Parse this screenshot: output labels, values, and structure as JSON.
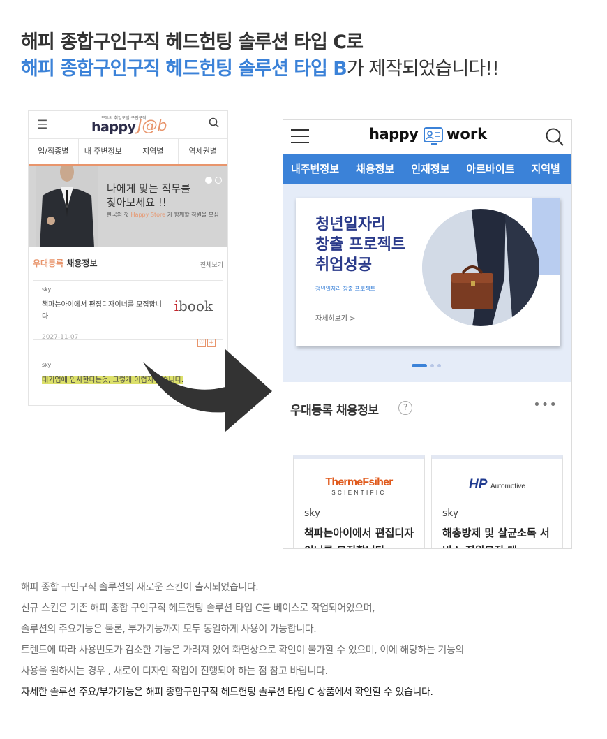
{
  "headline": {
    "line1": "해피 종합구인구직 헤드헌팅 솔루션 타입 C로",
    "line2_highlight": "해피 종합구인구직 헤드헌팅 솔루션 타입 B",
    "line2_rest": "가 제작되었습니다!!"
  },
  "old_skin": {
    "logo_tag": "모두의 취업포털 구인구직",
    "logo_happy": "happy",
    "logo_job": "J@b",
    "tabs": [
      "업/직종별",
      "내 주변정보",
      "지역별",
      "역세권별"
    ],
    "banner_title_1": "나에게 맞는 직무를",
    "banner_title_2": "찾아보세요 !!",
    "banner_sub_1": "한국의 첫 ",
    "banner_sub_highlight": "Happy Store",
    "banner_sub_2": " 가 함께할 직원을 모집",
    "section_title_highlight": "우대등록",
    "section_title_rest": " 채용정보",
    "section_more": "전체보기",
    "card1_company": "sky",
    "card1_text": "책파는아이에서 편집디자이너를 모집합니다",
    "card1_logo_i": "i",
    "card1_logo_rest": "book",
    "card1_date": "2027-11-07",
    "card2_company": "sky",
    "card2_text": "대기업에 입사한다는것, 그렇게 어렵지 않습니다."
  },
  "new_skin": {
    "logo_happy": "happy",
    "logo_work": "work",
    "nav": [
      "내주변정보",
      "채용정보",
      "인재정보",
      "아르바이트",
      "지역별"
    ],
    "hero_title_1": "청년일자리",
    "hero_title_2": "창출 프로젝트",
    "hero_title_3": "취업성공",
    "hero_sub": "청년일자리 창출 프로젝트",
    "hero_more": "자세히보기 >",
    "section_title": "우대등록 채용정보",
    "section_help": "?",
    "section_more": "•••",
    "cards": [
      {
        "logo_main": "ThermeFsiher",
        "logo_sub": "SCIENTIFIC",
        "company": "sky",
        "text": "책파는아이에서 편집디자이너를 모집합니다"
      },
      {
        "logo_main": "HP",
        "logo_sub": "Automotive",
        "company": "sky",
        "text": "해충방제 및 살균소독 서비스 직원모집 대…"
      }
    ]
  },
  "description": [
    "해피 종합 구인구직 솔루션의 새로운 스킨이 출시되었습니다.",
    "신규 스킨은 기존 해피 종합 구인구직 헤드헌팅 솔루션 타입 C를 베이스로 작업되어있으며,",
    "솔루션의 주요기능은 물론, 부가기능까지 모두 동일하게 사용이 가능합니다.",
    "트렌드에 따라 사용빈도가 감소한 기능은 가려져 있어 화면상으로 확인이 불가할 수 있으며, 이에 해당하는 기능의",
    "사용을 원하시는 경우 , 새로이 디자인 작업이 진행되야 하는 점 참고 바랍니다.",
    "자세한 솔루션 주요/부가기능은 해피 종합구인구직 헤드헌팅 솔루션 타입 C 상품에서 확인할 수 있습니다."
  ],
  "colors": {
    "accent_blue": "#3b82d8",
    "old_orange": "#e8956c",
    "text_dark": "#333333"
  }
}
